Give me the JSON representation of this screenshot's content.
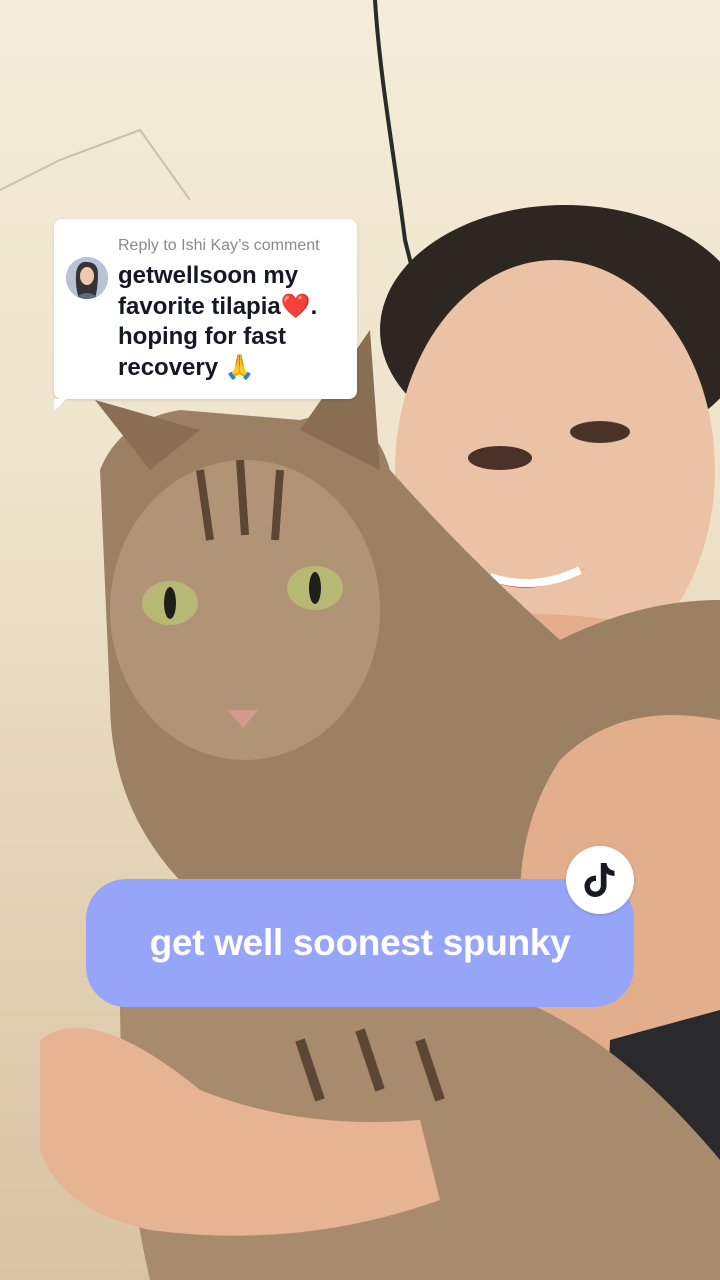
{
  "reply_sticker": {
    "header": "Reply to Ishi Kay’s comment",
    "avatar": "commenter-avatar",
    "comment_lines": [
      "getwellsoon my",
      "favorite tilapia❤️.",
      "hoping for fast",
      "recovery 🙏"
    ]
  },
  "caption": {
    "text": "get well soonest spunky"
  },
  "icons": {
    "tiktok": "tiktok-logo-icon"
  },
  "colors": {
    "caption_bubble": "#97a5f9",
    "caption_text": "#ffffff",
    "reply_card_bg": "#ffffff",
    "reply_header_text": "#8a8a8a",
    "reply_body_text": "#161823"
  }
}
